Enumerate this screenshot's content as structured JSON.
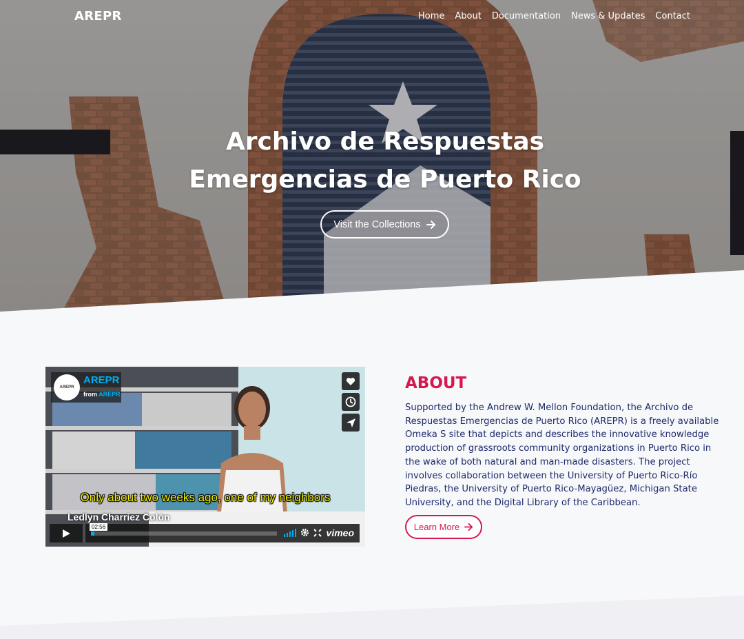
{
  "brand": "AREPR",
  "nav": {
    "items": [
      "Home",
      "About",
      "Documentation",
      "News & Updates",
      "Contact"
    ]
  },
  "hero": {
    "title_line1": "Archivo de Respuestas",
    "title_line2": "Emergencias de Puerto Rico",
    "cta_label": "Visit the Collections",
    "cta_icon": "arrow-right-icon"
  },
  "video": {
    "channel_title": "AREPR",
    "from_label": "from",
    "from_channel": "AREPR",
    "subtitle": "Only about two weeks ago, one of my neighbors",
    "speaker": "Ledlyn Charriez Colón",
    "time": "02:56",
    "progress_fraction": 0.02,
    "player_brand": "vimeo",
    "actions": [
      "heart-icon",
      "clock-icon",
      "send-icon"
    ]
  },
  "about": {
    "heading": "ABOUT",
    "body": "Supported by the Andrew W. Mellon Foundation, the Archivo de Respuestas Emergencias de Puerto Rico (AREPR) is a freely available Omeka S site that depicts and describes the innovative knowledge production of grassroots community organizations in Puerto Rico in the wake of both natural and man-made disasters. The project involves collaboration between the University of Puerto Rico-Río Piedras, the University of Puerto Rico-Mayagüez, Michigan State University, and the Digital Library of the Caribbean.",
    "button_label": "Learn More"
  },
  "colors": {
    "accent": "#d5184f",
    "text": "#1d2a6b",
    "page_bg": "#f7f8fa",
    "vimeo_blue": "#00adef"
  }
}
